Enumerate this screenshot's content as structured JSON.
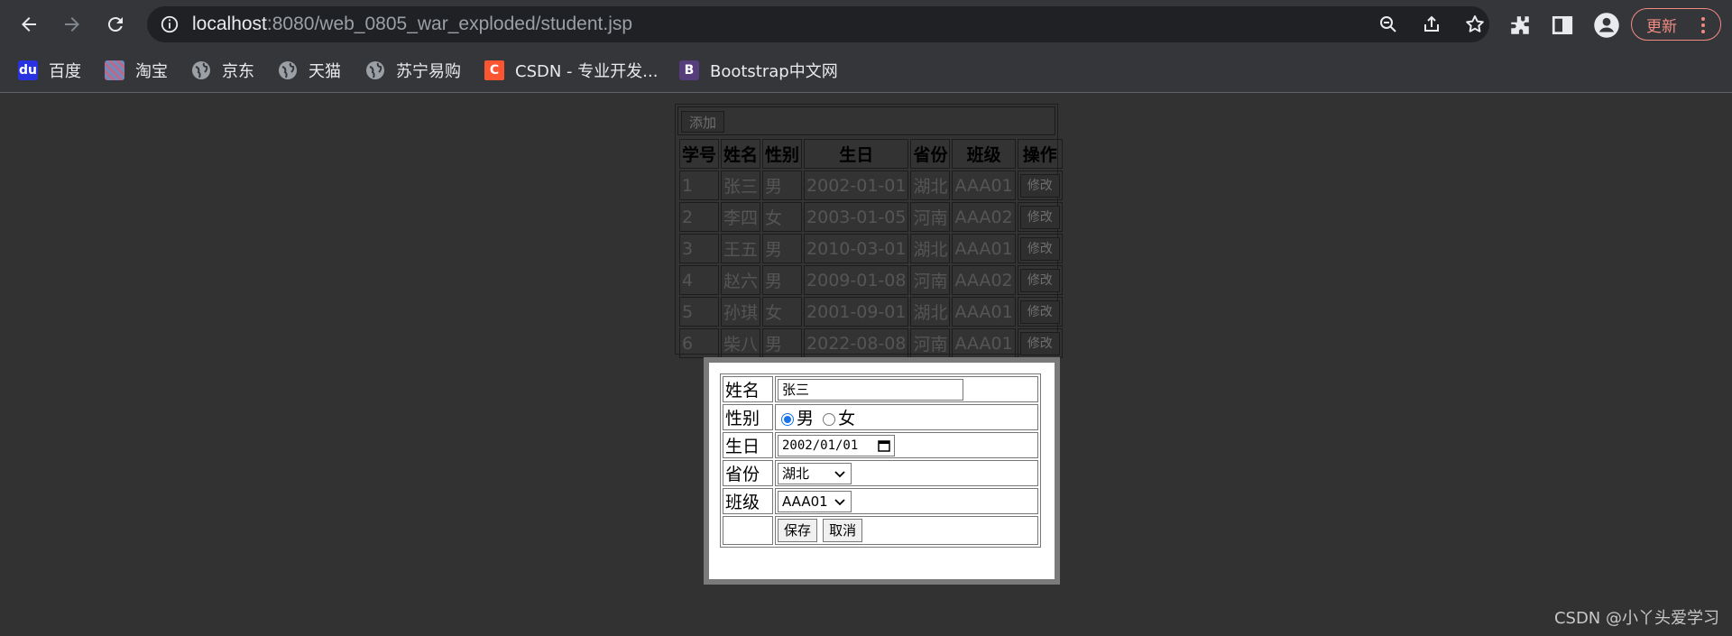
{
  "browser": {
    "url_host": "localhost",
    "url_path": ":8080/web_0805_war_exploded/student.jsp",
    "update_label": "更新"
  },
  "bookmarks": [
    {
      "label": "百度",
      "icon": "baidu-icon"
    },
    {
      "label": "淘宝",
      "icon": "taobao-icon"
    },
    {
      "label": "京东",
      "icon": "globe-icon"
    },
    {
      "label": "天猫",
      "icon": "globe-icon"
    },
    {
      "label": "苏宁易购",
      "icon": "globe-icon"
    },
    {
      "label": "CSDN - 专业开发...",
      "icon": "csdn-icon"
    },
    {
      "label": "Bootstrap中文网",
      "icon": "bootstrap-icon"
    }
  ],
  "list": {
    "add_label": "添加",
    "headers": [
      "学号",
      "姓名",
      "性别",
      "生日",
      "省份",
      "班级",
      "操作"
    ],
    "edit_label": "修改",
    "rows": [
      [
        "1",
        "张三",
        "男",
        "2002-01-01",
        "湖北",
        "AAA01"
      ],
      [
        "2",
        "李四",
        "女",
        "2003-01-05",
        "河南",
        "AAA02"
      ],
      [
        "3",
        "王五",
        "男",
        "2010-03-01",
        "湖北",
        "AAA01"
      ],
      [
        "4",
        "赵六",
        "男",
        "2009-01-08",
        "河南",
        "AAA02"
      ],
      [
        "5",
        "孙琪",
        "女",
        "2001-09-01",
        "湖北",
        "AAA01"
      ],
      [
        "6",
        "柴八",
        "男",
        "2022-08-08",
        "河南",
        "AAA01"
      ]
    ]
  },
  "form": {
    "name_label": "姓名",
    "name_value": "张三",
    "gender_label": "性别",
    "gender_male": "男",
    "gender_female": "女",
    "birthday_label": "生日",
    "birthday_value": "2002/01/01",
    "province_label": "省份",
    "province_value": "湖北",
    "class_label": "班级",
    "class_value": "AAA01",
    "save_label": "保存",
    "cancel_label": "取消"
  },
  "watermark": "CSDN @小丫头爱学习",
  "colors": {
    "accent": "#1a73e8",
    "update": "#f28b82"
  }
}
